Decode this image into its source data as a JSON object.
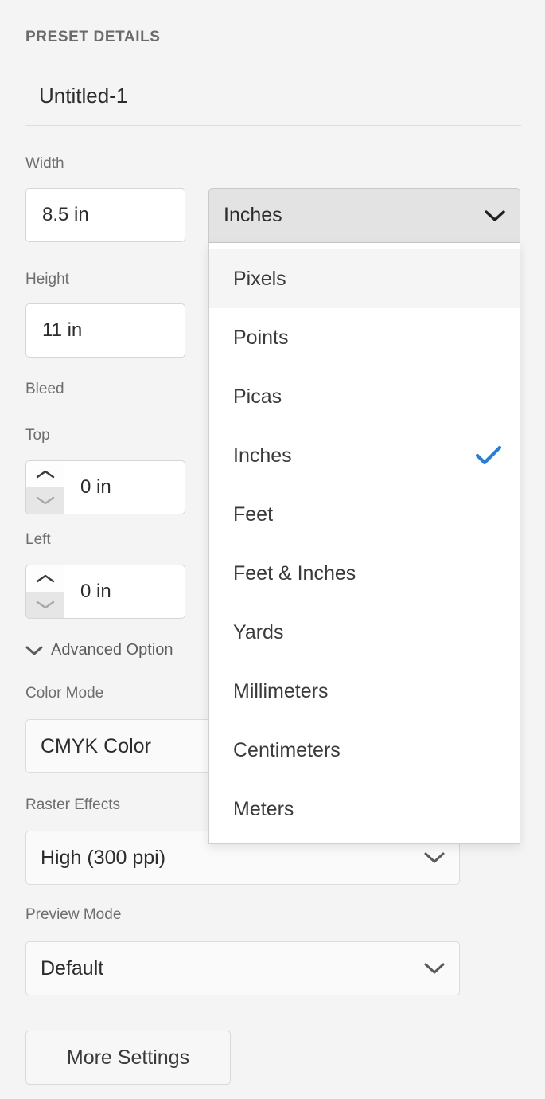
{
  "header": {
    "section_title": "PRESET DETAILS",
    "preset_name_value": "Untitled-1",
    "preset_name_placeholder": "Untitled-1"
  },
  "fields": {
    "width": {
      "label": "Width",
      "value": "8.5 in",
      "placeholder": "8.5 in"
    },
    "units": {
      "selected": "Inches"
    },
    "height": {
      "label": "Height",
      "value": "11 in",
      "placeholder": "11 in"
    },
    "bleed": {
      "label": "Bleed",
      "top": {
        "label": "Top",
        "value": "0 in",
        "placeholder": "0 in"
      },
      "left": {
        "label": "Left",
        "value": "0 in",
        "placeholder": "0 in"
      }
    },
    "advanced_options": {
      "label": "Advanced Option"
    },
    "color_mode": {
      "label": "Color Mode",
      "value": "CMYK Color"
    },
    "raster_effects": {
      "label": "Raster Effects",
      "value": "High (300 ppi)"
    },
    "preview_mode": {
      "label": "Preview Mode",
      "value": "Default"
    }
  },
  "buttons": {
    "more_settings": "More Settings"
  },
  "unit_dropdown": {
    "open": true,
    "items": [
      {
        "label": "Pixels",
        "checked": false,
        "hovered": true
      },
      {
        "label": "Points",
        "checked": false,
        "hovered": false
      },
      {
        "label": "Picas",
        "checked": false,
        "hovered": false
      },
      {
        "label": "Inches",
        "checked": true,
        "hovered": false
      },
      {
        "label": "Feet",
        "checked": false,
        "hovered": false
      },
      {
        "label": "Feet & Inches",
        "checked": false,
        "hovered": false
      },
      {
        "label": "Yards",
        "checked": false,
        "hovered": false
      },
      {
        "label": "Millimeters",
        "checked": false,
        "hovered": false
      },
      {
        "label": "Centimeters",
        "checked": false,
        "hovered": false
      },
      {
        "label": "Meters",
        "checked": false,
        "hovered": false
      }
    ]
  },
  "icons": {
    "chevron_down": "chevron-down-icon",
    "chevron_up": "chevron-up-icon",
    "checkmark": "checkmark-icon"
  },
  "colors": {
    "panel_background": "#f4f4f4",
    "accent_check": "#2b7cd3",
    "text_primary": "#2c2c2c",
    "text_label": "#6e6e6e",
    "input_background": "#ffffff",
    "combo_open_background": "#e3e3e3"
  }
}
